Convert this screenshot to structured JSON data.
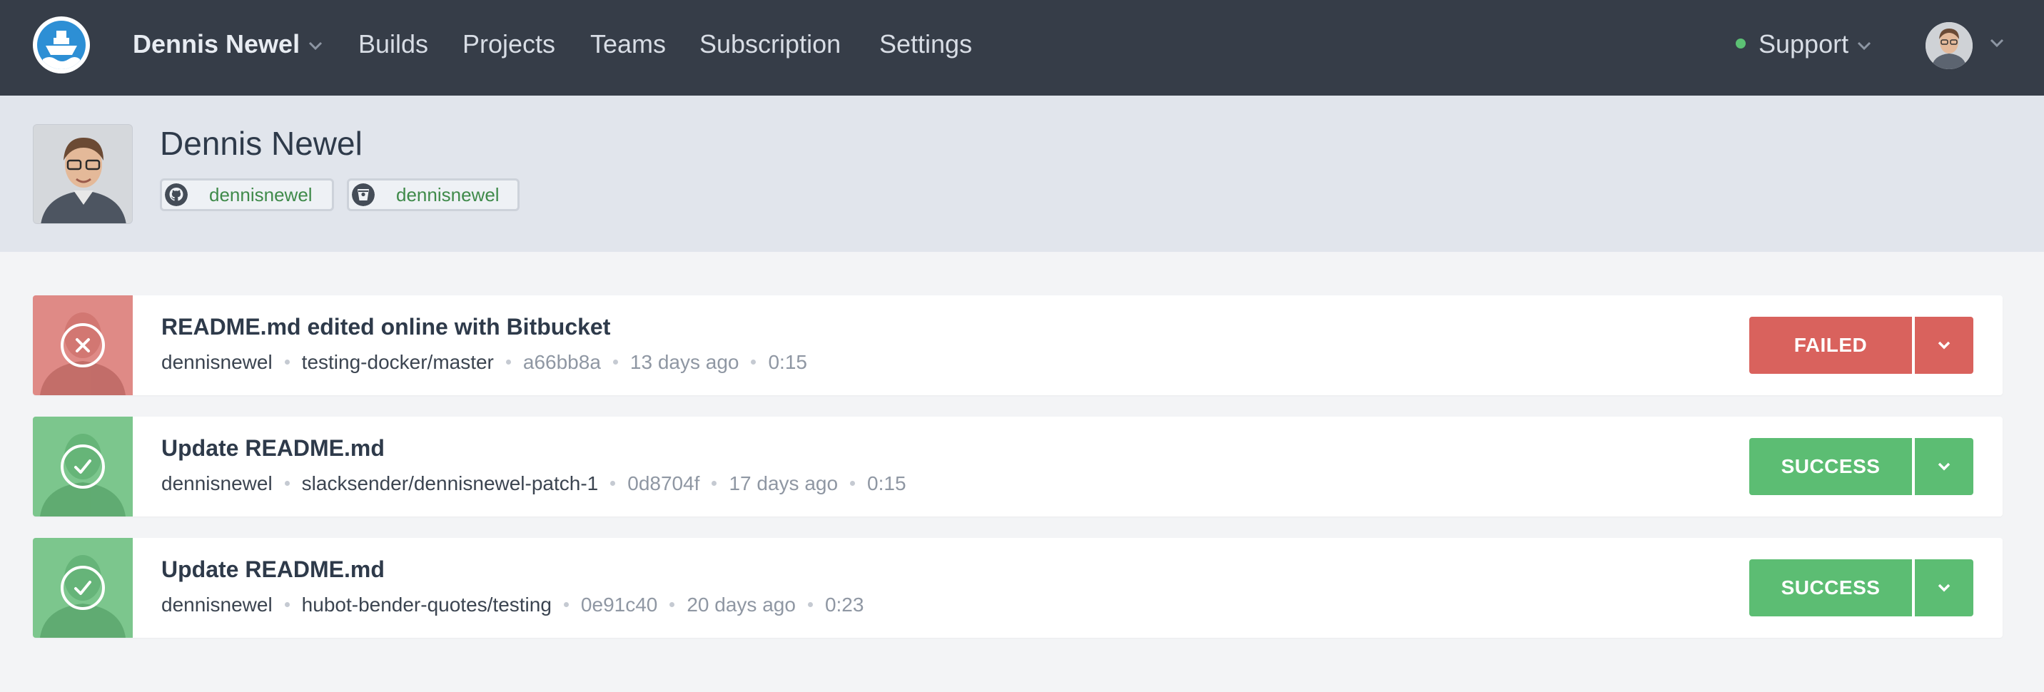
{
  "nav": {
    "account_name": "Dennis Newel",
    "items": [
      {
        "label": "Builds"
      },
      {
        "label": "Projects"
      },
      {
        "label": "Teams"
      },
      {
        "label": "Subscription"
      },
      {
        "label": "Settings"
      }
    ],
    "support_label": "Support",
    "support_status_color": "#5cc174",
    "logo_icon": "ship-logo-icon",
    "user_avatar_icon": "user-avatar"
  },
  "profile": {
    "name": "Dennis Newel",
    "github": {
      "icon": "github-icon",
      "username": "dennisnewel"
    },
    "bitbucket": {
      "icon": "bitbucket-icon",
      "username": "dennisnewel"
    }
  },
  "builds": [
    {
      "title": "README.md edited online with Bitbucket",
      "author": "dennisnewel",
      "branch": "testing-docker/master",
      "commit": "a66bb8a",
      "time": "13 days ago",
      "duration": "0:15",
      "status": "FAILED",
      "status_icon": "x-circle-icon",
      "color": "#d9625d"
    },
    {
      "title": "Update README.md",
      "author": "dennisnewel",
      "branch": "slacksender/dennisnewel-patch-1",
      "commit": "0d8704f",
      "time": "17 days ago",
      "duration": "0:15",
      "status": "SUCCESS",
      "status_icon": "check-circle-icon",
      "color": "#5cbd73"
    },
    {
      "title": "Update README.md",
      "author": "dennisnewel",
      "branch": "hubot-bender-quotes/testing",
      "commit": "0e91c40",
      "time": "20 days ago",
      "duration": "0:23",
      "status": "SUCCESS",
      "status_icon": "check-circle-icon",
      "color": "#5cbd73"
    }
  ]
}
